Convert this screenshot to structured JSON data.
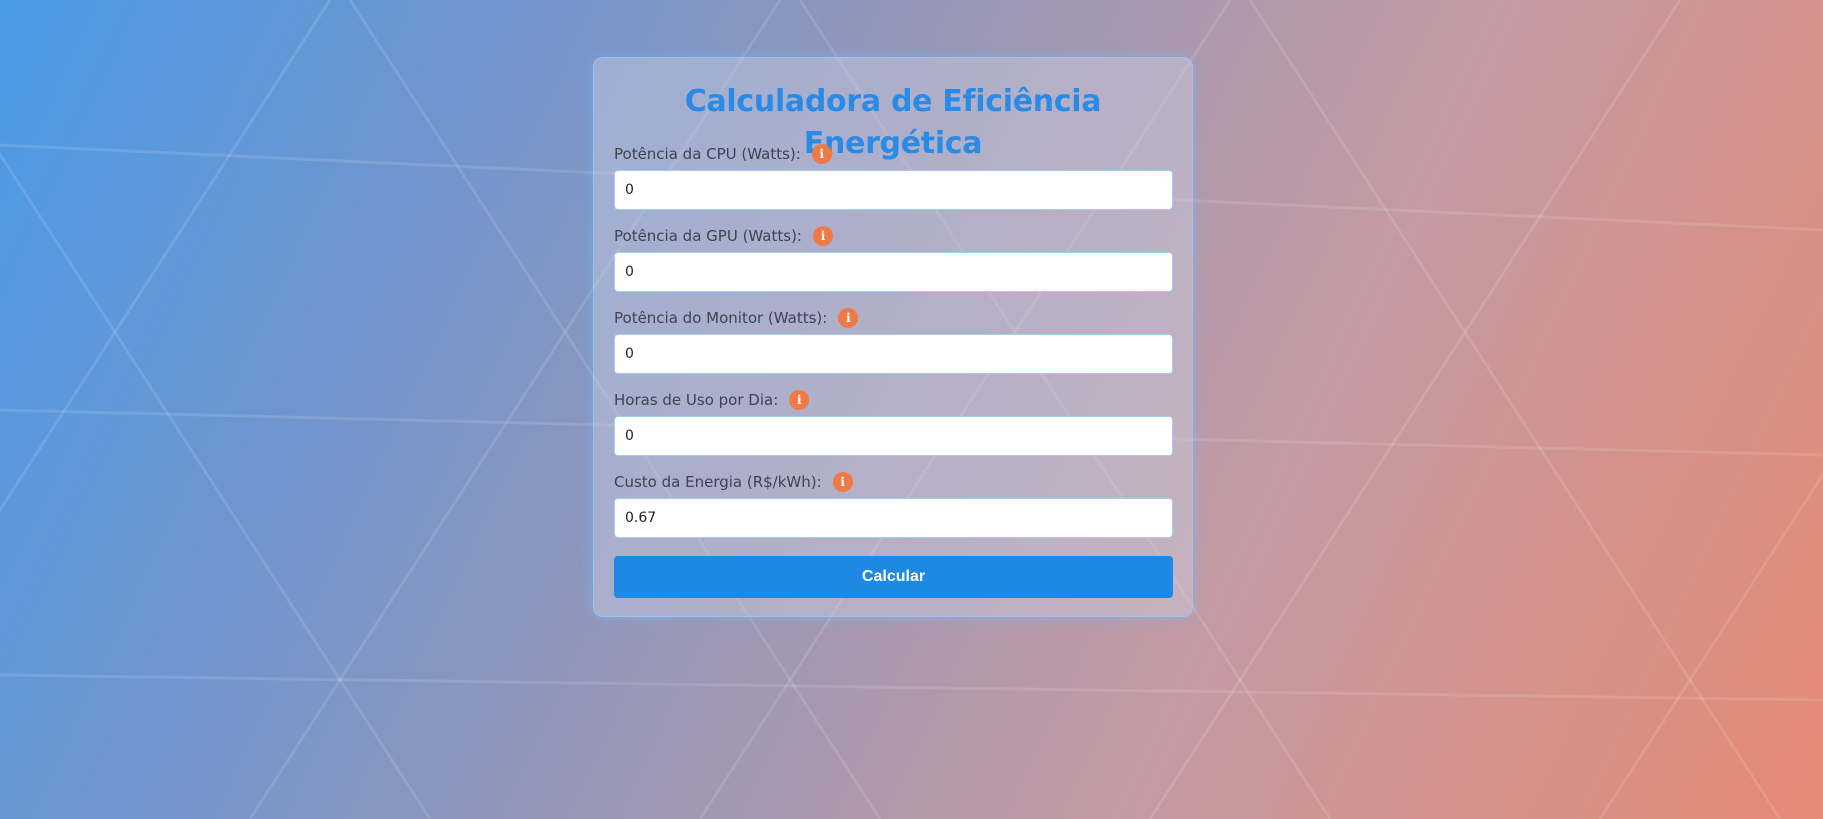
{
  "page": {
    "title": "Calculadora de Eficiência Energética",
    "accent_color": "#2a8be6",
    "button_color": "#1e88e5",
    "info_icon_color": "#f07a45"
  },
  "fields": [
    {
      "label": "Potência da CPU (Watts):",
      "value": "0",
      "icon": "info-icon"
    },
    {
      "label": "Potência da GPU (Watts):",
      "value": "0",
      "icon": "info-icon"
    },
    {
      "label": "Potência do Monitor (Watts):",
      "value": "0",
      "icon": "info-icon"
    },
    {
      "label": "Horas de Uso por Dia:",
      "value": "0",
      "icon": "info-icon"
    },
    {
      "label": "Custo da Energia (R$/kWh):",
      "value": "0.67",
      "icon": "info-icon"
    }
  ],
  "actions": {
    "calculate_label": "Calcular"
  }
}
